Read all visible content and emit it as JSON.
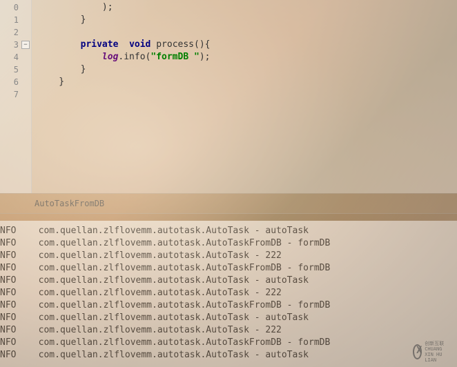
{
  "editor": {
    "lines": [
      {
        "num": "0",
        "indent": "            ",
        "tokens": [
          {
            "t": ");",
            "c": ""
          }
        ]
      },
      {
        "num": "1",
        "indent": "        ",
        "tokens": [
          {
            "t": "}",
            "c": ""
          }
        ]
      },
      {
        "num": "2",
        "indent": "",
        "tokens": []
      },
      {
        "num": "3",
        "indent": "        ",
        "tokens": [
          {
            "t": "private",
            "c": "kw"
          },
          {
            "t": "  ",
            "c": ""
          },
          {
            "t": "void",
            "c": "kw"
          },
          {
            "t": " process(){",
            "c": ""
          }
        ],
        "fold": true
      },
      {
        "num": "4",
        "indent": "            ",
        "tokens": [
          {
            "t": "log",
            "c": "fld"
          },
          {
            "t": ".info(",
            "c": ""
          },
          {
            "t": "\"formDB \"",
            "c": "str"
          },
          {
            "t": ");",
            "c": ""
          }
        ]
      },
      {
        "num": "5",
        "indent": "        ",
        "tokens": [
          {
            "t": "}",
            "c": ""
          }
        ]
      },
      {
        "num": "6",
        "indent": "    ",
        "tokens": [
          {
            "t": "}",
            "c": ""
          }
        ]
      },
      {
        "num": "7",
        "indent": "",
        "tokens": []
      }
    ],
    "tab": "AutoTaskFromDB"
  },
  "console": {
    "logs": [
      {
        "level": "NFO",
        "msg": "com.quellan.zlflovemm.autotask.AutoTask - autoTask"
      },
      {
        "level": "NFO",
        "msg": "com.quellan.zlflovemm.autotask.AutoTaskFromDB - formDB"
      },
      {
        "level": "NFO",
        "msg": "com.quellan.zlflovemm.autotask.AutoTask - 222"
      },
      {
        "level": "NFO",
        "msg": "com.quellan.zlflovemm.autotask.AutoTaskFromDB - formDB"
      },
      {
        "level": "NFO",
        "msg": "com.quellan.zlflovemm.autotask.AutoTask - autoTask"
      },
      {
        "level": "NFO",
        "msg": "com.quellan.zlflovemm.autotask.AutoTask - 222"
      },
      {
        "level": "NFO",
        "msg": "com.quellan.zlflovemm.autotask.AutoTaskFromDB - formDB"
      },
      {
        "level": "NFO",
        "msg": "com.quellan.zlflovemm.autotask.AutoTask - autoTask"
      },
      {
        "level": "NFO",
        "msg": "com.quellan.zlflovemm.autotask.AutoTask - 222"
      },
      {
        "level": "NFO",
        "msg": "com.quellan.zlflovemm.autotask.AutoTaskFromDB - formDB"
      },
      {
        "level": "NFO",
        "msg": "com.quellan.zlflovemm.autotask.AutoTask - autoTask"
      }
    ]
  },
  "watermark": {
    "brand": "创新互联",
    "sub": "CHUANG XIN HU LIAN"
  }
}
